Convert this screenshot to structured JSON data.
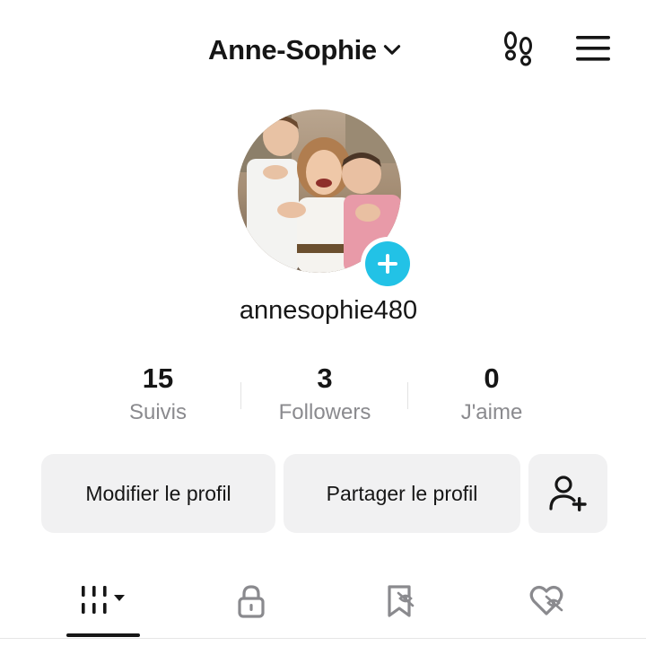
{
  "header": {
    "display_name": "Anne-Sophie",
    "icons": {
      "switcher": "chevron-down-icon",
      "footprints": "footprints-icon",
      "menu": "hamburger-menu-icon"
    }
  },
  "profile": {
    "avatar": "profile-photo",
    "add_icon": "plus-icon",
    "handle": "annesophie480"
  },
  "stats": [
    {
      "value": "15",
      "label": "Suivis"
    },
    {
      "value": "3",
      "label": "Followers"
    },
    {
      "value": "0",
      "label": "J'aime"
    }
  ],
  "actions": {
    "edit_label": "Modifier le profil",
    "share_label": "Partager le profil",
    "add_friend_icon": "add-user-icon"
  },
  "tabs": [
    {
      "icon": "videos-grid-icon",
      "selected": true
    },
    {
      "icon": "lock-icon",
      "selected": false
    },
    {
      "icon": "saved-bookmark-icon",
      "selected": false
    },
    {
      "icon": "liked-heart-icon",
      "selected": false
    }
  ],
  "colors": {
    "accent": "#22c2e6",
    "text": "#161616",
    "muted": "#8a8a8e",
    "button_bg": "#f1f1f2"
  }
}
